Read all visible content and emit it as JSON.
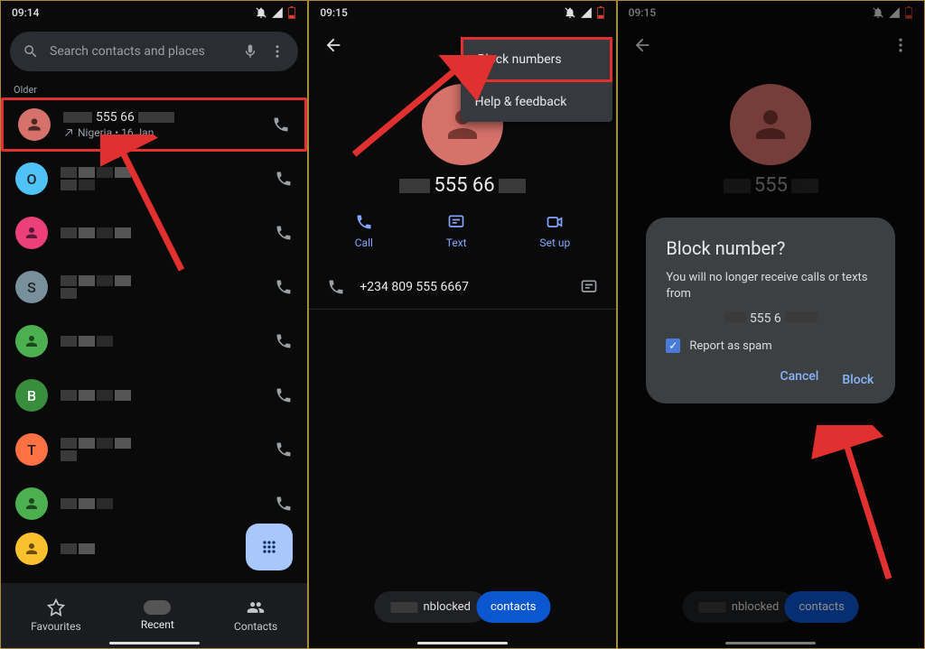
{
  "panel1": {
    "time": "09:14",
    "search_placeholder": "Search contacts and places",
    "older_label": "Older",
    "top_call": {
      "number_suffix": "555 66",
      "sub": "Nigeria • 16 Jan"
    },
    "letters": [
      "O",
      "",
      "S",
      "",
      "B",
      "T",
      "",
      ""
    ],
    "nav": {
      "fav": "Favourites",
      "recent": "Recent",
      "contacts": "Contacts"
    }
  },
  "panel2": {
    "time": "09:15",
    "menu": {
      "block": "Block numbers",
      "help": "Help & feedback"
    },
    "name_mid": " 555 66",
    "actions": {
      "call": "Call",
      "text": "Text",
      "setup": "Set up"
    },
    "full_number": "+234 809 555 6667",
    "toast": {
      "pill": "nblocked",
      "chip": "contacts"
    }
  },
  "panel3": {
    "time": "09:15",
    "name_mid": "555",
    "dialog": {
      "title": "Block number?",
      "body": "You will no longer receive calls or texts from",
      "num": "555 6",
      "spam": "Report as spam",
      "cancel": "Cancel",
      "block": "Block"
    },
    "toast": {
      "pill": "nblocked",
      "chip": "contacts"
    }
  }
}
